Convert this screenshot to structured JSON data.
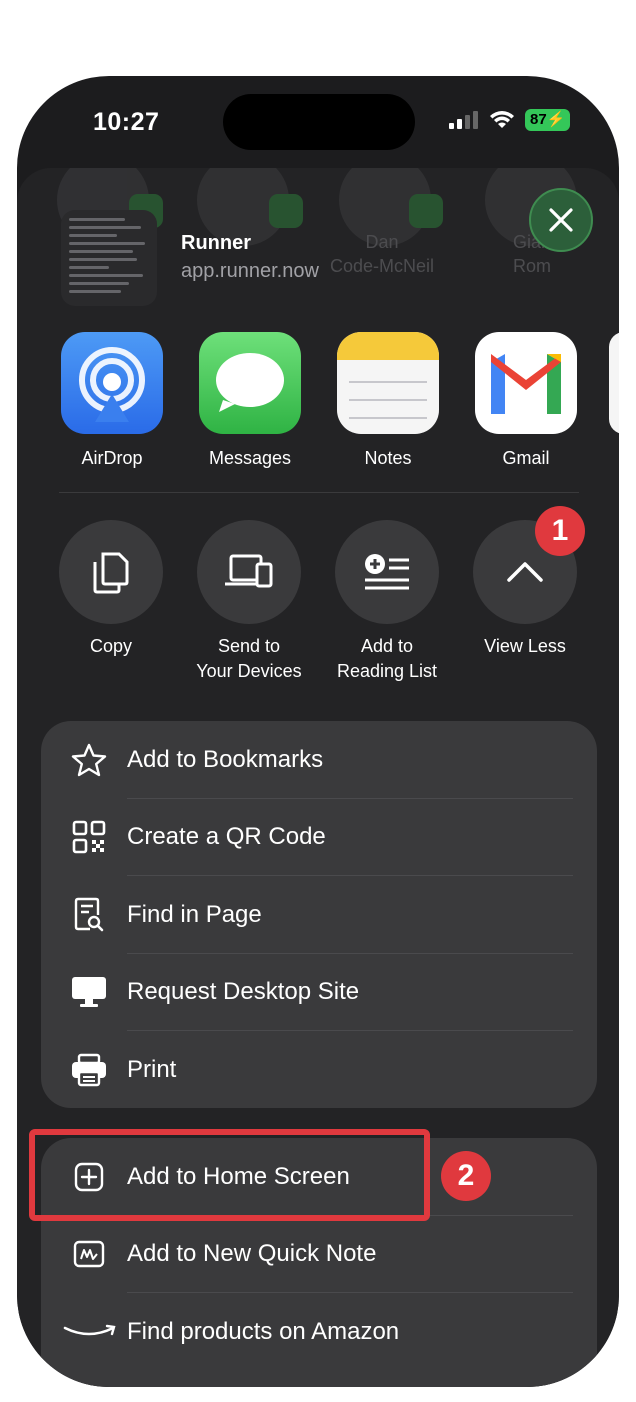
{
  "status_bar": {
    "time": "10:27",
    "battery": "87"
  },
  "share_header": {
    "app_name": "Runner",
    "app_url": "app.runner.now",
    "background_contacts": [
      "Dan\nCode-McNeil",
      "Gian\nRom"
    ]
  },
  "apps": [
    {
      "label": "AirDrop",
      "icon": "airdrop-icon"
    },
    {
      "label": "Messages",
      "icon": "messages-icon"
    },
    {
      "label": "Notes",
      "icon": "notes-icon"
    },
    {
      "label": "Gmail",
      "icon": "gmail-icon"
    }
  ],
  "actions": [
    {
      "label": "Copy",
      "icon": "copy-icon"
    },
    {
      "label": "Send to\nYour Devices",
      "icon": "devices-icon"
    },
    {
      "label": "Add to\nReading List",
      "icon": "reading-list-icon"
    },
    {
      "label": "View Less",
      "icon": "chevron-up-icon"
    }
  ],
  "menu_group_1": [
    {
      "label": "Add to Bookmarks",
      "icon": "star-icon"
    },
    {
      "label": "Create a QR Code",
      "icon": "qr-code-icon"
    },
    {
      "label": "Find in Page",
      "icon": "find-in-page-icon"
    },
    {
      "label": "Request Desktop Site",
      "icon": "desktop-icon"
    },
    {
      "label": "Print",
      "icon": "printer-icon"
    }
  ],
  "menu_group_2": [
    {
      "label": "Add to Home Screen",
      "icon": "plus-square-icon"
    },
    {
      "label": "Add to New Quick Note",
      "icon": "quick-note-icon"
    },
    {
      "label": "Find products on Amazon",
      "icon": "amazon-icon"
    }
  ],
  "callouts": {
    "first": "1",
    "second": "2"
  },
  "colors": {
    "accent_red": "#e0393e",
    "sheet_bg": "#232325",
    "group_bg": "#3a3a3c"
  }
}
